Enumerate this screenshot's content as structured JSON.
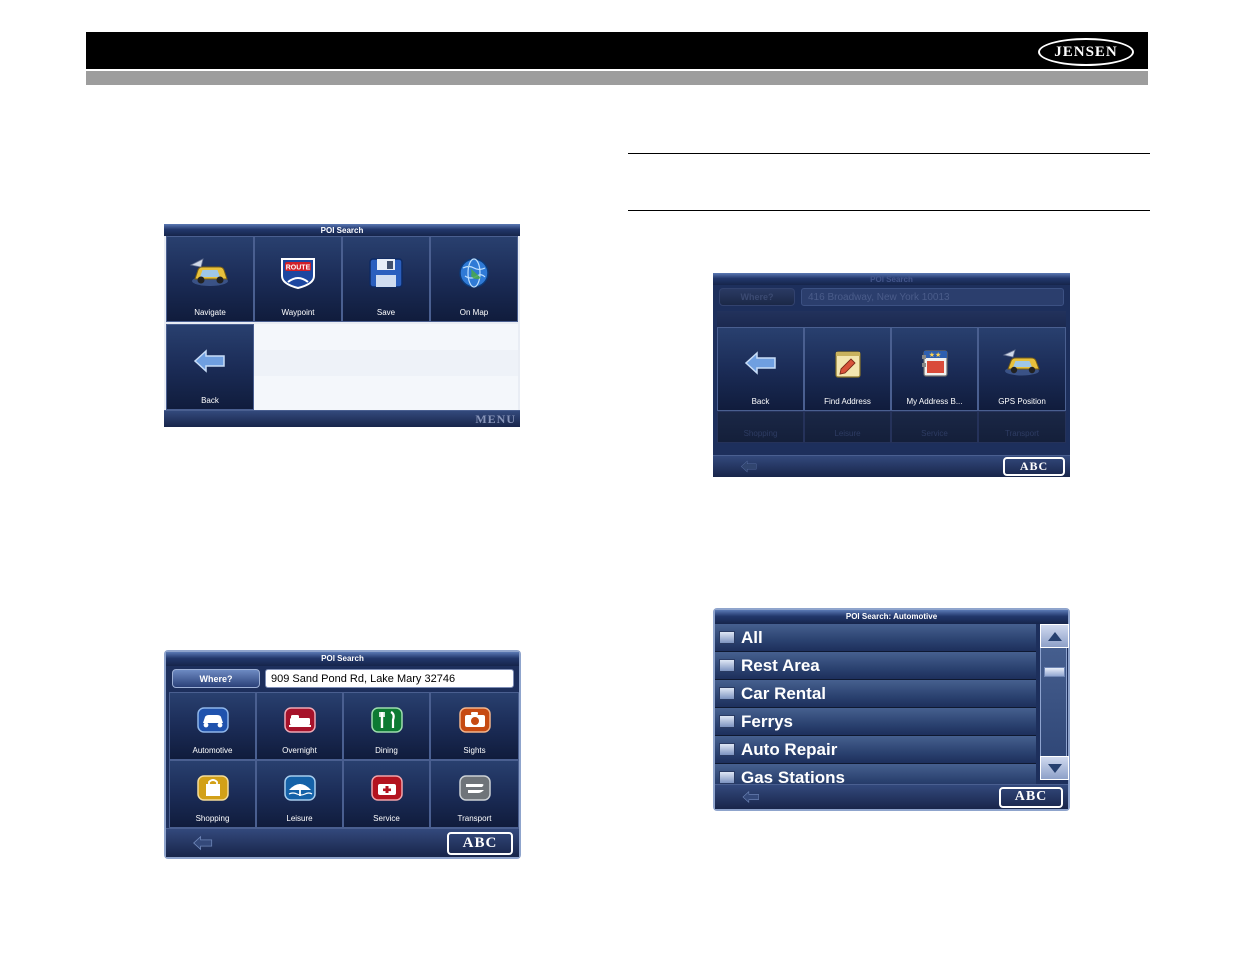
{
  "header": {
    "brand": "JENSEN"
  },
  "screens": {
    "route_options": {
      "title": "POI Search",
      "tiles": [
        {
          "label": "Navigate",
          "icon": "car-navigate-icon"
        },
        {
          "label": "Waypoint",
          "icon": "route-shield-icon"
        },
        {
          "label": "Save",
          "icon": "floppy-disk-icon"
        },
        {
          "label": "On Map",
          "icon": "globe-icon"
        },
        {
          "label": "Back",
          "icon": "back-arrow-icon"
        }
      ],
      "bottom_label": "MENU"
    },
    "address_entry": {
      "title": "POI Search",
      "where_button": "Where?",
      "address_value": "416 Broadway, New York 10013",
      "tiles": [
        {
          "label": "Back",
          "icon": "back-arrow-icon"
        },
        {
          "label": "Find Address",
          "icon": "notepad-icon"
        },
        {
          "label": "My Address B...",
          "icon": "address-book-icon"
        },
        {
          "label": "GPS Position",
          "icon": "gps-car-icon"
        }
      ],
      "dim_tiles": [
        {
          "label": "Shopping"
        },
        {
          "label": "Leisure"
        },
        {
          "label": "Service"
        },
        {
          "label": "Transport"
        }
      ],
      "bottom_label": "ABC"
    },
    "poi_search": {
      "title": "POI Search",
      "where_button": "Where?",
      "address_value": "909 Sand Pond Rd, Lake Mary 32746",
      "tiles": [
        {
          "label": "Automotive",
          "icon": "car-icon"
        },
        {
          "label": "Overnight",
          "icon": "bed-icon"
        },
        {
          "label": "Dining",
          "icon": "cutlery-icon"
        },
        {
          "label": "Sights",
          "icon": "camera-icon"
        },
        {
          "label": "Shopping",
          "icon": "shopping-bag-icon"
        },
        {
          "label": "Leisure",
          "icon": "beach-umbrella-icon"
        },
        {
          "label": "Service",
          "icon": "first-aid-icon"
        },
        {
          "label": "Transport",
          "icon": "transport-icon"
        }
      ],
      "bottom_label": "ABC"
    },
    "poi_automotive": {
      "title": "POI Search: Automotive",
      "rows": [
        {
          "label": "All",
          "icon": "poi-item-icon"
        },
        {
          "label": "Rest Area",
          "icon": "poi-item-icon"
        },
        {
          "label": "Car Rental",
          "icon": "poi-item-icon"
        },
        {
          "label": "Ferrys",
          "icon": "poi-item-icon"
        },
        {
          "label": "Auto Repair",
          "icon": "poi-item-icon"
        },
        {
          "label": "Gas Stations",
          "icon": "poi-item-icon"
        }
      ],
      "scroll_up": "▲",
      "scroll_down": "▼",
      "bottom_label": "ABC"
    }
  }
}
